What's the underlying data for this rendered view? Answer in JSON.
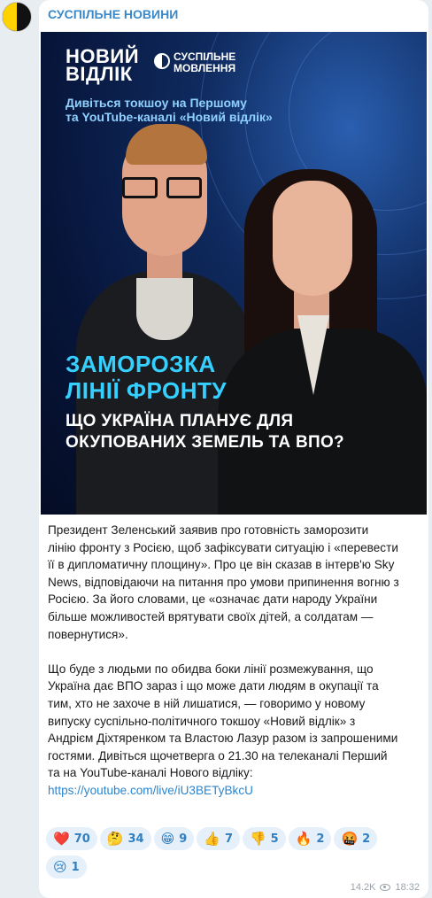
{
  "channel": {
    "name": "СУСПІЛЬНЕ НОВИНИ"
  },
  "promo": {
    "logo_line1": "НОВИЙ",
    "logo_line2": "ВІДЛІК",
    "partner_line1": "СУСПІЛЬНЕ",
    "partner_line2": "МОВЛЕННЯ",
    "tagline_line1": "Дивіться токшоу на Першому",
    "tagline_line2": "та YouTube-каналі «Новий відлік»",
    "headline_line1": "ЗАМОРОЗКА",
    "headline_line2": "ЛІНІЇ ФРОНТУ",
    "subhead_line1": "ЩО УКРАЇНА ПЛАНУЄ ДЛЯ",
    "subhead_line2": "ОКУПОВАНИХ ЗЕМЕЛЬ ТА ВПО?"
  },
  "post": {
    "paragraph1": "Президент Зеленський заявив про готовність заморозити\nлінію фронту з Росією, щоб зафіксувати ситуацію і «перевести\nїї в дипломатичну площину». Про це він сказав в інтерв'ю Sky\nNews, відповідаючи на питання про умови припинення вогню з\nРосією. За його словами, це «означає дати народу України\nбільше можливостей врятувати своїх дітей, а солдатам —\nповернутися».",
    "paragraph2": "Що буде з людьми по обидва боки лінії розмежування, що\nУкраїна дає ВПО зараз і що може дати людям в окупації та\nтим, хто не захоче в ній лишатися, — говоримо у новому\nвипуску суспільно-політичного токшоу «Новий відлік» з\nАндрієм Діхтяренком та Властою Лазур разом із запрошеними\nгостями. Дивіться щочетверга о 21.30 на телеканалі Перший\nта на YouTube-каналі Нового відліку:",
    "link": "https://youtube.com/live/iU3BETyBkcU"
  },
  "reactions": [
    {
      "emoji": "❤️",
      "count": "70"
    },
    {
      "emoji": "🤔",
      "count": "34"
    },
    {
      "emoji": "😁",
      "count": "9"
    },
    {
      "emoji": "👍",
      "count": "7"
    },
    {
      "emoji": "👎",
      "count": "5"
    },
    {
      "emoji": "🔥",
      "count": "2"
    },
    {
      "emoji": "🤬",
      "count": "2"
    },
    {
      "emoji": "😢",
      "count": "1"
    }
  ],
  "meta": {
    "views": "14.2K",
    "time": "18:32"
  }
}
